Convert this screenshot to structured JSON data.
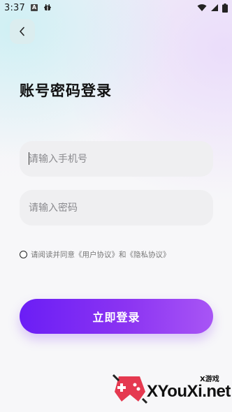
{
  "status_bar": {
    "time": "3:37",
    "notification_letter": "A"
  },
  "header": {
    "back_icon": "chevron-left-icon"
  },
  "page": {
    "title": "账号密码登录"
  },
  "form": {
    "phone": {
      "placeholder": "请输入手机号",
      "value": ""
    },
    "password": {
      "placeholder": "请输入密码",
      "value": ""
    },
    "agreement": {
      "text": "请阅读并同意《用户协议》和《隐私协议》",
      "checked": false
    },
    "submit_label": "立即登录"
  },
  "watermark": {
    "small_text": "X游戏",
    "brand": "XYouXi.net"
  },
  "colors": {
    "button_start": "#6b1ef5",
    "button_end": "#a855f5",
    "field_bg": "#efeff1"
  }
}
